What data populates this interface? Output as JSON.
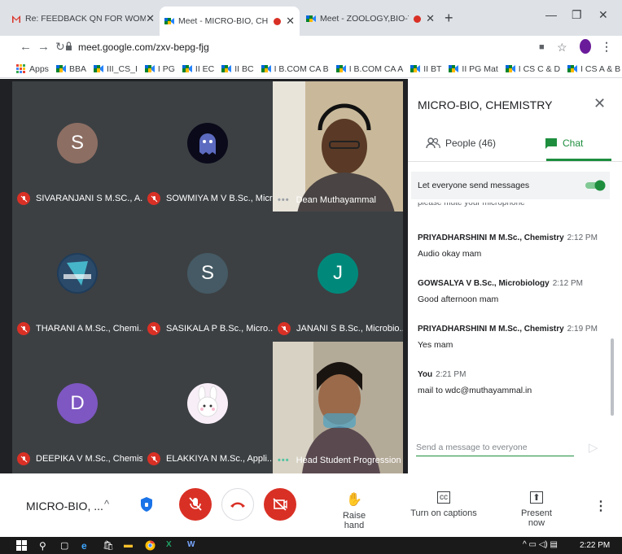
{
  "browser": {
    "tabs": [
      {
        "title": "Re: FEEDBACK QN FOR WOMEN",
        "icon": "gmail-icon"
      },
      {
        "title": "Meet - MICRO-BIO, CHEMIST",
        "icon": "meet-icon",
        "recording": true
      },
      {
        "title": "Meet - ZOOLOGY,BIO-TECH",
        "icon": "meet-icon",
        "recording": true
      }
    ],
    "url": "meet.google.com/zxv-bepg-fjg",
    "bookmarks": [
      "Apps",
      "BBA",
      "III_CS_I",
      "I PG",
      "II EC",
      "II BC",
      "I B.COM CA B",
      "I B.COM CA A",
      "II BT",
      "II PG Mat",
      "I CS C & D",
      "I CS A & B"
    ]
  },
  "tiles": [
    {
      "name": "SIVARANJANI S M.SC., A...",
      "initial": "S",
      "color": "#8d6e63",
      "muted": true
    },
    {
      "name": "SOWMIYA M V B.Sc., Micr...",
      "initial": "",
      "color": "#101020",
      "muted": true
    },
    {
      "name": "Dean Muthayammal",
      "initial": "",
      "video": true,
      "muted": false
    },
    {
      "name": "THARANI A M.Sc., Chemi...",
      "initial": "",
      "color": "#1f3c5a",
      "muted": true
    },
    {
      "name": "SASIKALA P B.Sc., Micro...",
      "initial": "S",
      "color": "#455a64",
      "muted": true
    },
    {
      "name": "JANANI S B.Sc., Microbio...",
      "initial": "J",
      "color": "#00897b",
      "muted": true
    },
    {
      "name": "DEEPIKA V M.Sc., Chemis...",
      "initial": "D",
      "color": "#7e57c2",
      "muted": true
    },
    {
      "name": "ELAKKIYA N M.Sc., Appli...",
      "initial": "",
      "color": "#f3e5f5",
      "muted": true
    },
    {
      "name": "Head Student Progression",
      "initial": "",
      "video": true,
      "muted": false
    }
  ],
  "panel": {
    "title": "MICRO-BIO, CHEMISTRY",
    "people_tab": "People (46)",
    "chat_tab": "Chat",
    "everyone_label": "Let everyone send messages",
    "cut_message": "please mute your microphone",
    "messages": [
      {
        "who": "PRIYADHARSHINI M M.Sc., Chemistry",
        "time": "2:12 PM",
        "text": "Audio okay mam"
      },
      {
        "who": "GOWSALYA V B.Sc., Microbiology",
        "time": "2:12 PM",
        "text": "Good afternoon mam"
      },
      {
        "who": "PRIYADHARSHINI M M.Sc., Chemistry",
        "time": "2:19 PM",
        "text": "Yes mam"
      },
      {
        "who": "You",
        "time": "2:21 PM",
        "text": "mail to wdc@muthayammal.in"
      }
    ],
    "input_placeholder": "Send a message to everyone"
  },
  "bottom": {
    "meeting_name": "MICRO-BIO, ...",
    "raise_hand": "Raise hand",
    "captions": "Turn on captions",
    "present": "Present now"
  },
  "taskbar": {
    "time": "2:22 PM"
  },
  "colors": {
    "accent_green": "#1e8e3e",
    "red": "#d93025",
    "stage": "#202124"
  }
}
